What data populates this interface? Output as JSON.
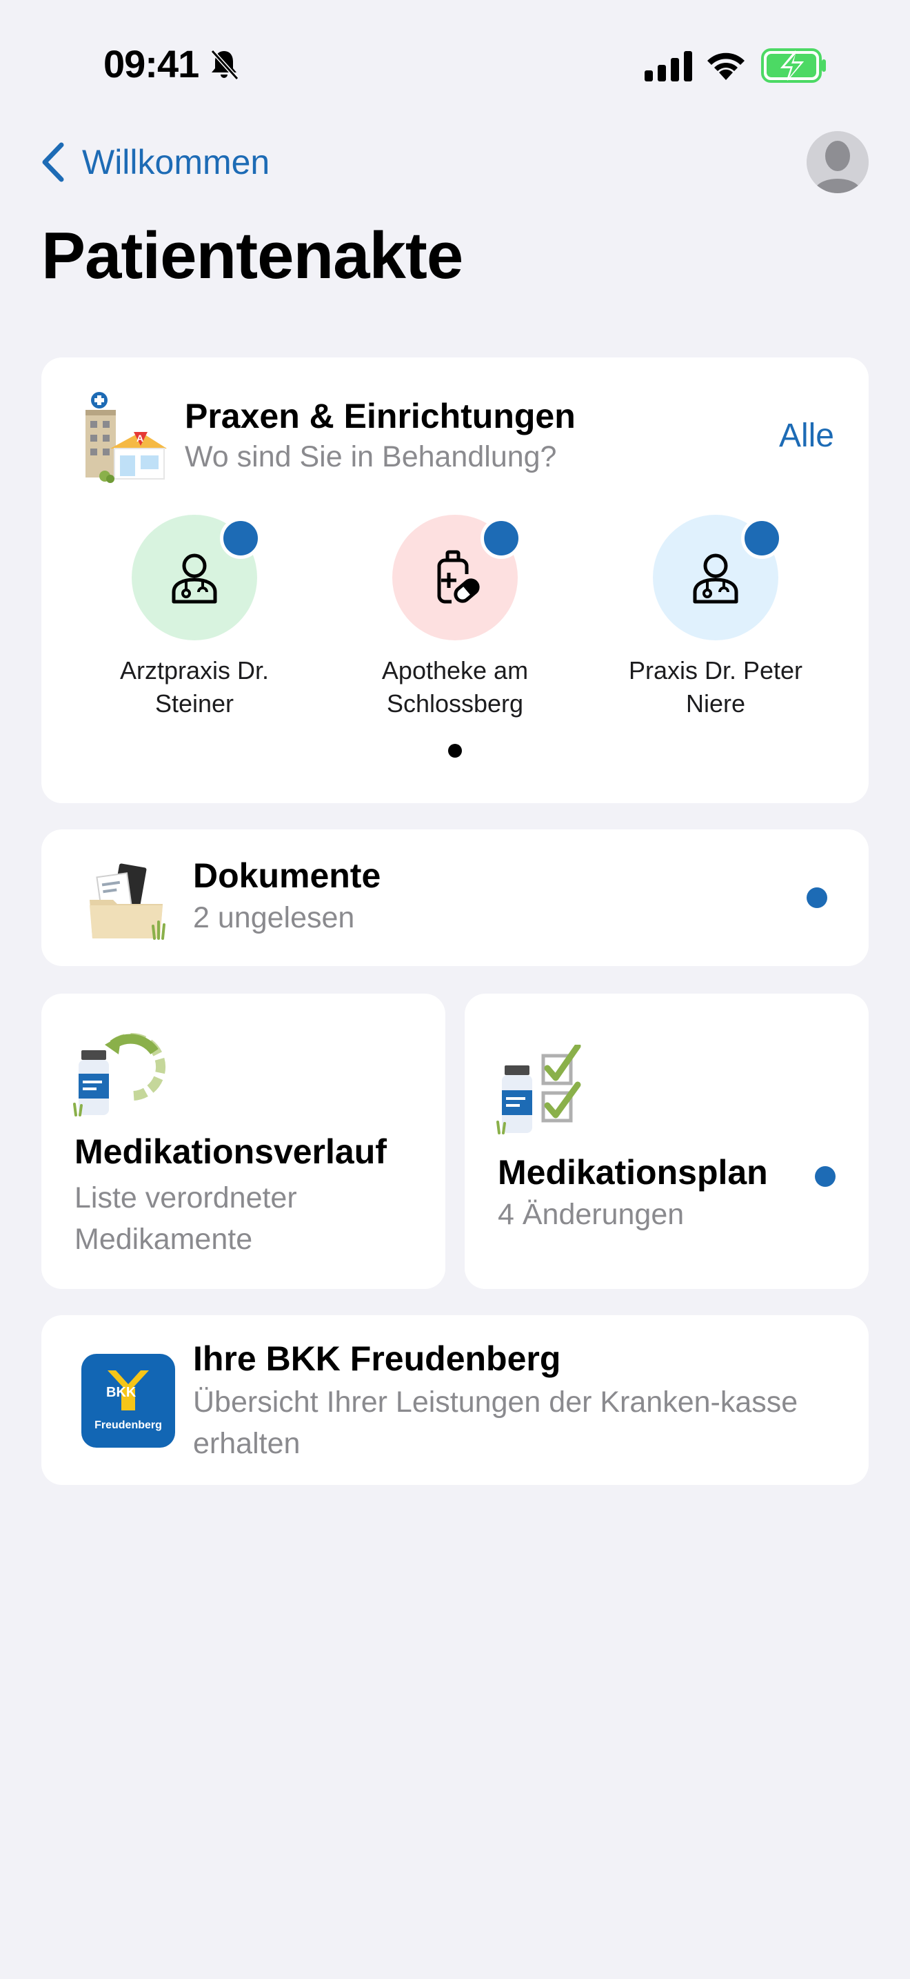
{
  "status_bar": {
    "time": "09:41",
    "icons": [
      "bell-slash-icon",
      "cellular-signal-icon",
      "wifi-icon",
      "battery-charging-icon"
    ],
    "battery_color": "#4cd964"
  },
  "nav": {
    "back_label": "Willkommen",
    "accent_color": "#1d6bb5"
  },
  "page_title": "Patientenakte",
  "facilities_card": {
    "title": "Praxen & Einrichtungen",
    "subtitle": "Wo sind Sie in Behandlung?",
    "all_label": "Alle",
    "items": [
      {
        "name": "Arztpraxis Dr. Steiner",
        "icon": "doctor-icon",
        "circle_color": "#d8f3df",
        "unread": true
      },
      {
        "name": "Apotheke am Schlossberg",
        "icon": "pharmacy-icon",
        "circle_color": "#fde0e0",
        "unread": true
      },
      {
        "name": "Praxis Dr. Peter Niere",
        "icon": "doctor-icon",
        "circle_color": "#e0f1fd",
        "unread": true
      }
    ],
    "page_indicator": {
      "count": 1,
      "active": 1
    }
  },
  "documents_card": {
    "title": "Dokumente",
    "subtitle": "2 ungelesen",
    "icon": "documents-folder-icon",
    "unread": true
  },
  "medication_history_card": {
    "title": "Medikationsverlauf",
    "subtitle": "Liste verordneter Medikamente",
    "icon": "medication-history-icon"
  },
  "medication_plan_card": {
    "title": "Medikationsplan",
    "subtitle": "4 Änderungen",
    "icon": "medication-plan-icon",
    "unread": true
  },
  "insurance_card": {
    "title": "Ihre BKK Freudenberg",
    "subtitle": "Übersicht Ihrer Leistungen der Kranken-kasse erhalten",
    "logo": {
      "line1": "BKK",
      "line2": "Freudenberg",
      "color": "#1266b4"
    }
  }
}
